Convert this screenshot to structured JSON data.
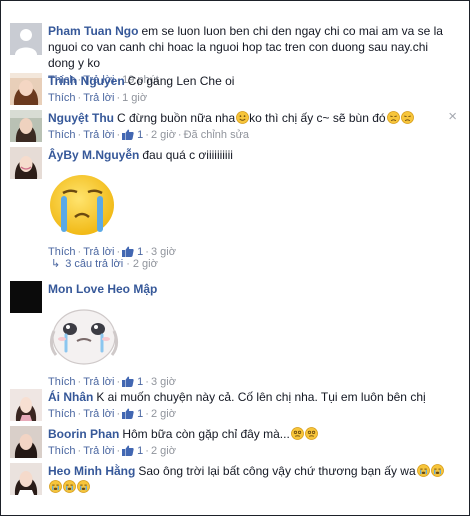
{
  "actions": {
    "like": "Thích",
    "reply": "Trả lời",
    "dot": "·"
  },
  "close_icon_glyph": "×",
  "replies_toggle": {
    "arrow": "↳",
    "label": "3 câu trả lời",
    "time": "2 giờ"
  },
  "comments": [
    {
      "author": "Pham Tuan Ngo",
      "text": "em se luon luon ben chi den ngay chi co mai am va se la nguoi co van canh chi hoac la nguoi hop tac tren con duong sau nay.chi dong y ko",
      "time": "19 phút",
      "avatar_icon": "default-avatar"
    },
    {
      "author": "Trinh Nguyen",
      "text": "Co gang Len Che oi",
      "time": "1 giờ",
      "avatar_icon": "photo-avatar"
    },
    {
      "author": "Nguyệt Thu",
      "text": "C đừng buồn nữa nha",
      "text2": "ko thì chị ấy c~ sẽ bùn đó",
      "likes": "1",
      "time": "2 giờ",
      "edited": "Đã chỉnh sửa",
      "avatar_icon": "photo-avatar"
    },
    {
      "author": "ÂyBy M.Nguyễn",
      "text": "đau quá c ơiiiiiiiiii",
      "likes": "1",
      "time": "3 giờ",
      "sticker": "crying-face-sticker",
      "avatar_icon": "photo-avatar"
    },
    {
      "author": "Mon Love Heo Mập",
      "text": "",
      "likes": "1",
      "time": "3 giờ",
      "sticker": "crying-bunny-sticker",
      "avatar_icon": "black-avatar"
    },
    {
      "author": "Ái Nhân",
      "text": "K ai muốn chuyện này cả. Cố lên chị nha. Tụi em luôn bên chị",
      "likes": "1",
      "time": "2 giờ",
      "avatar_icon": "photo-avatar"
    },
    {
      "author": "Boorin Phan",
      "text": "Hôm bữa còn gặp chỉ đây mà...",
      "likes": "1",
      "time": "2 giờ",
      "avatar_icon": "photo-avatar"
    },
    {
      "author": "Heo Minh Hằng",
      "text": "Sao ông trời lại bất công vậy chứ thương bạn ấy wa",
      "avatar_icon": "photo-avatar"
    }
  ],
  "colors": {
    "author": "#365899",
    "action": "#4b67a1",
    "meta": "#90949c",
    "like_badge": "#4267b2"
  }
}
